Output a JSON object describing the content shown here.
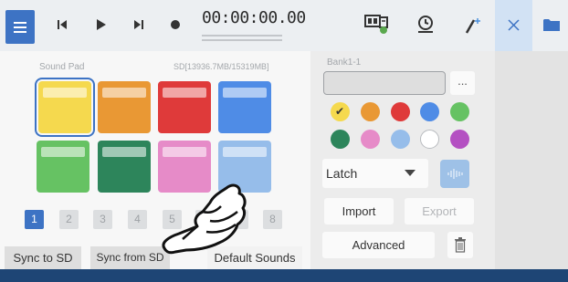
{
  "toolbar": {
    "timecode": "00:00:00.00",
    "icons": [
      "menu-icon",
      "previous-icon",
      "play-icon",
      "next-icon",
      "record-icon",
      "sound-pad-settings-icon",
      "timer-icon",
      "effect-icon",
      "close-icon",
      "folder-icon"
    ],
    "accent": "#3d73c4"
  },
  "sound_pad": {
    "title": "Sound Pad",
    "storage": "SD[13936.7MB/15319MB]",
    "pads": [
      {
        "color": "#f5d94e",
        "selected": true
      },
      {
        "color": "#e99834"
      },
      {
        "color": "#df3a3a"
      },
      {
        "color": "#4f8ce6"
      },
      {
        "color": "#66c263"
      },
      {
        "color": "#2d855b"
      },
      {
        "color": "#e68bc8"
      },
      {
        "color": "#96bdea"
      }
    ],
    "pages": [
      "1",
      "2",
      "3",
      "4",
      "5",
      "6",
      "7",
      "8"
    ],
    "active_page": "1",
    "sync_to_sd": "Sync to SD",
    "sync_from_sd": "Sync from SD",
    "default_sounds": "Default Sounds"
  },
  "pad_settings": {
    "bank_label": "Bank1-1",
    "name_value": "",
    "more_label": "...",
    "colors": [
      "#f5d94e",
      "#e99834",
      "#df3a3a",
      "#4f8ce6",
      "#66c263",
      "#2d855b",
      "#e68bc8",
      "#96bdea",
      "#ffffff",
      "#b450c2"
    ],
    "selected_color_index": 0,
    "mode": "Latch",
    "import_label": "Import",
    "export_label": "Export",
    "advanced_label": "Advanced"
  }
}
